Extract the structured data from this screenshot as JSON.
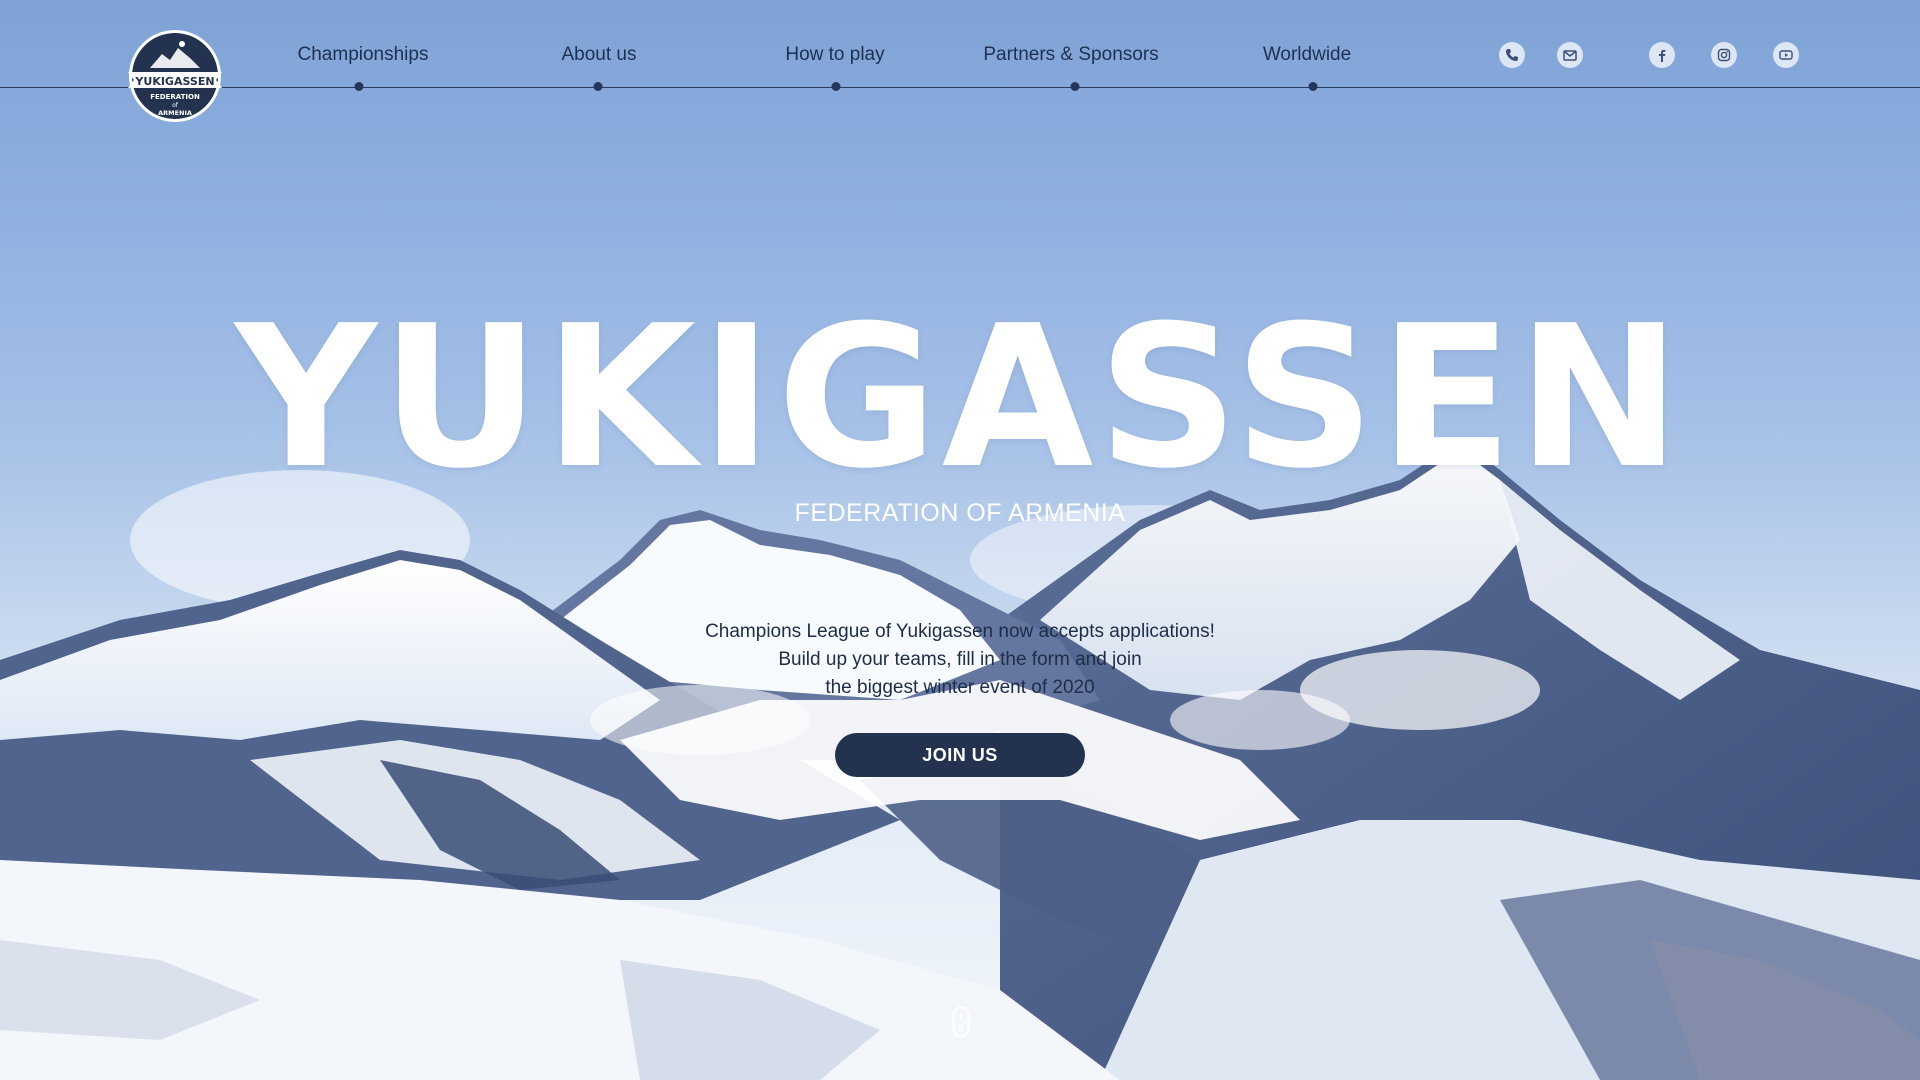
{
  "logo": {
    "title": "YUKIGASSEN",
    "line1": "FEDERATION",
    "line2": "of",
    "line3": "ARMENIA"
  },
  "nav": {
    "items": [
      {
        "label": "Championships"
      },
      {
        "label": "About us"
      },
      {
        "label": "How to play"
      },
      {
        "label": "Partners & Sponsors"
      },
      {
        "label": "Worldwide"
      }
    ]
  },
  "contact": {
    "icons": [
      "phone-icon",
      "mail-icon"
    ]
  },
  "social": {
    "icons": [
      "facebook-icon",
      "instagram-icon",
      "youtube-icon"
    ]
  },
  "hero": {
    "title": "YUKIGASSEN",
    "subtitle": "FEDERATION OF ARMENIA",
    "description": [
      "Champions League of Yukigassen now accepts applications!",
      "Build up your teams, fill in the form and join",
      "the biggest winter event of 2020"
    ],
    "cta_label": "JOIN US",
    "scroll_icon": "mouse-scroll-icon"
  },
  "colors": {
    "accent": "#22324f",
    "nav_text": "#1f3050",
    "sky": "#86a9dc"
  }
}
